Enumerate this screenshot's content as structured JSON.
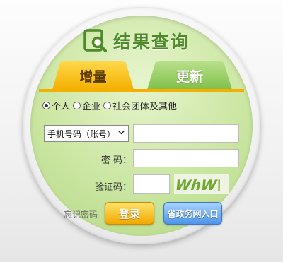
{
  "header": {
    "title": "结果查询",
    "icon": "search-document-icon",
    "accent": "#4f8a2a"
  },
  "tabs": [
    {
      "label": "增量",
      "active": true,
      "color": "#f4b000"
    },
    {
      "label": "更新",
      "active": false,
      "color": "#7fbf4a"
    }
  ],
  "user_type": {
    "options": [
      "个人",
      "企业",
      "社会团体及其他"
    ],
    "selected": "个人"
  },
  "form": {
    "account_type": {
      "selected": "手机号码（账号）"
    },
    "account_value": "",
    "password_label": "密  码：",
    "password_value": "",
    "captcha_label": "验证码：",
    "captcha_value": "",
    "captcha_image_text": "WhW\\"
  },
  "footer": {
    "forgot_label": "忘记密码",
    "login_label": "登录",
    "portal_label": "省政务网入口"
  }
}
